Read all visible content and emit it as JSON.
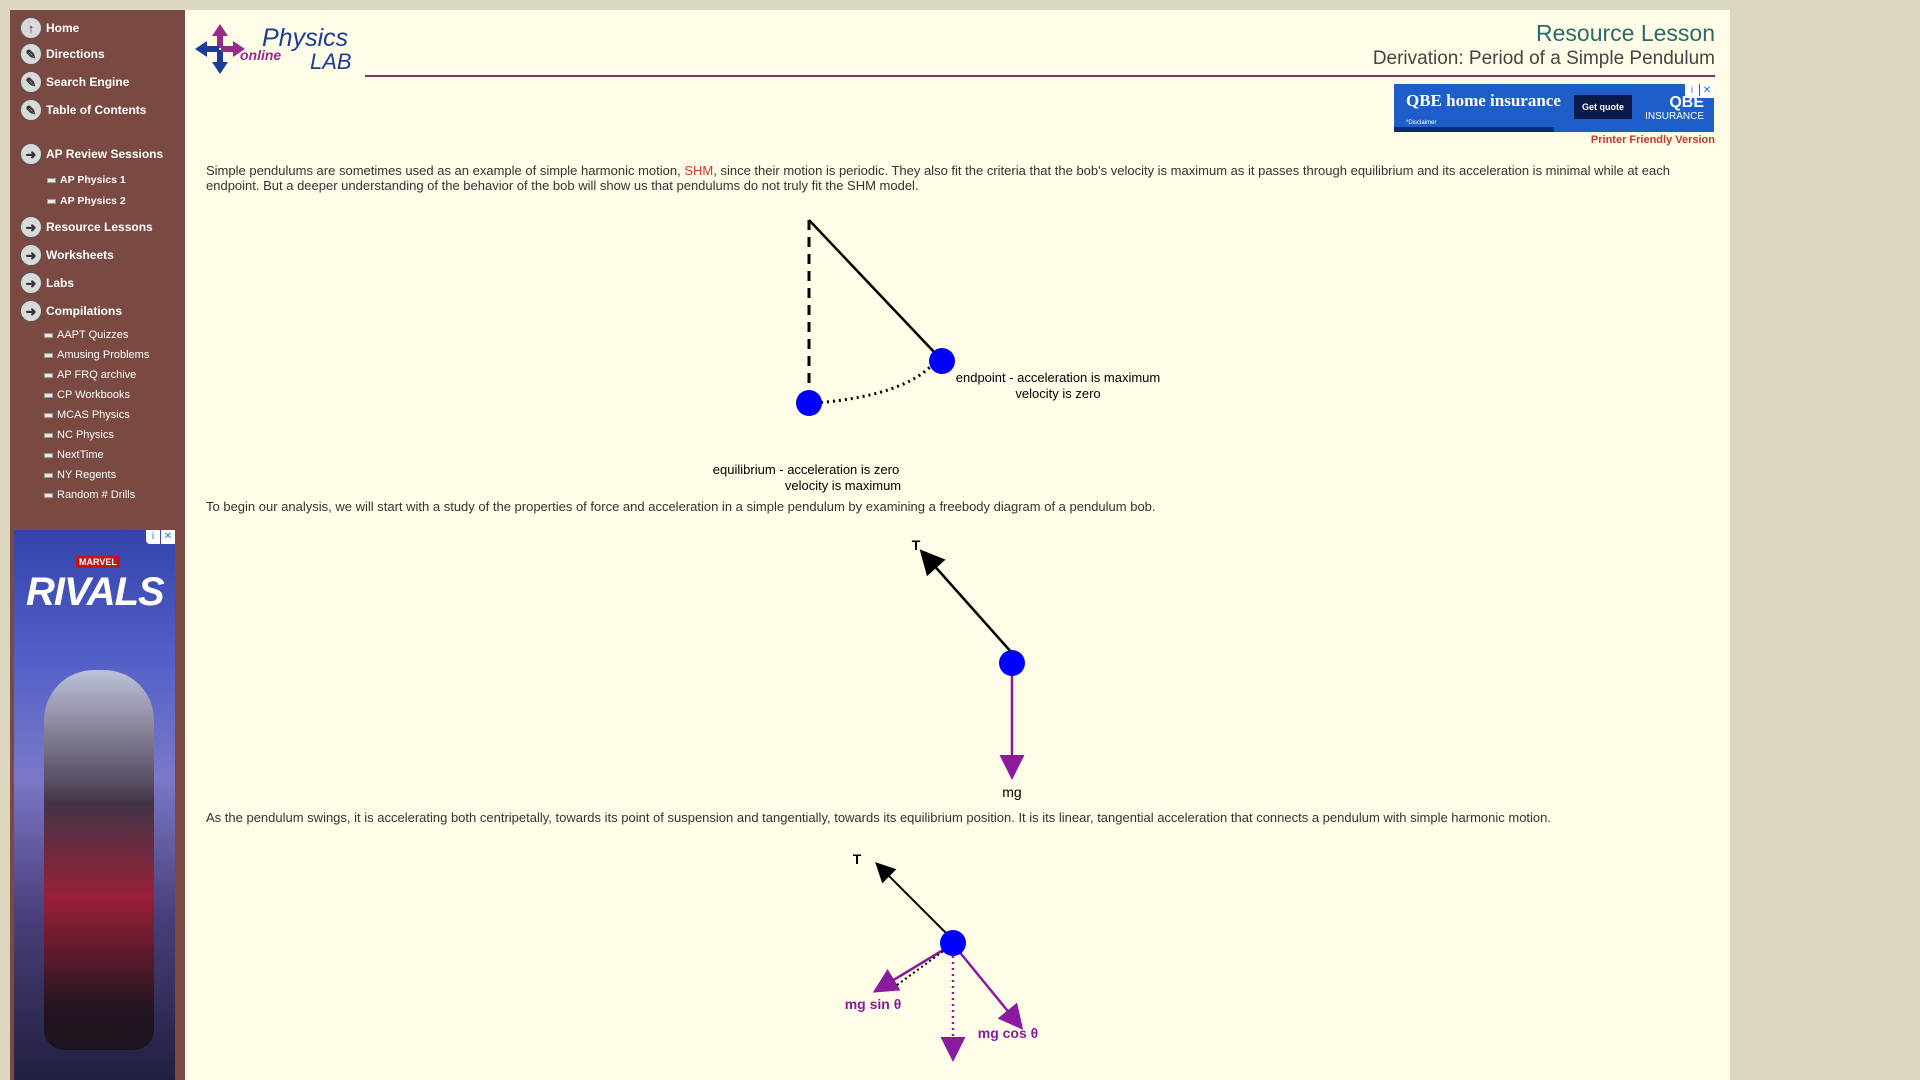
{
  "sidebar": {
    "nav": [
      {
        "label": "Home",
        "icon": "home-icon"
      },
      {
        "label": "Directions",
        "icon": "pencil-icon"
      },
      {
        "label": "Search Engine",
        "icon": "pencil-icon"
      },
      {
        "label": "Table of Contents",
        "icon": "pencil-icon"
      },
      {
        "label": "AP Review Sessions",
        "icon": "arrow-right-icon"
      },
      {
        "label": "Resource Lessons",
        "icon": "arrow-right-icon"
      },
      {
        "label": "Worksheets",
        "icon": "arrow-right-icon"
      },
      {
        "label": "Labs",
        "icon": "arrow-right-icon"
      },
      {
        "label": "Compilations",
        "icon": "arrow-right-icon"
      }
    ],
    "ap_sub": [
      "AP Physics 1",
      "AP Physics 2"
    ],
    "compilations_sub": [
      "AAPT Quizzes",
      "Amusing Problems",
      "AP FRQ archive",
      "CP Workbooks",
      "MCAS Physics",
      "NC Physics",
      "NextTime",
      "NY Regents",
      "Random # Drills"
    ],
    "ad": {
      "brand_small": "MARVEL",
      "brand_big": "RIVALS"
    }
  },
  "logo": {
    "word1": "Physics",
    "word2": "online",
    "word3": "LAB"
  },
  "header": {
    "title": "Resource Lesson",
    "subtitle": "Derivation: Period of a Simple Pendulum"
  },
  "top_ad": {
    "name": "QBE home insurance",
    "cta": "Get quote",
    "disclaimer": "*Disclaimer",
    "logo": "QBE",
    "logo_sub": "INSURANCE"
  },
  "printer_link": "Printer Friendly Version",
  "paragraphs": {
    "p1_before": "Simple pendulums are sometimes used as an example of simple harmonic motion, ",
    "p1_link": "SHM",
    "p1_after": ", since their motion is periodic. They also fit the criteria that the bob's velocity is maximum as it passes through equilibrium and its acceleration is minimal while at each endpoint. But a deeper understanding of the behavior of the bob will show us that pendulums do not truly fit the SHM model.",
    "p2": "To begin our analysis, we will start with a study of the properties of force and acceleration in a simple pendulum by examining a freebody diagram of a pendulum bob.",
    "p3": "As the pendulum swings, it is accelerating both centripetally, towards its point of suspension and tangentially, towards its equilibrium position. It is its linear, tangential acceleration that connects a pendulum with simple harmonic motion."
  },
  "diagram1": {
    "endpoint_line1": "endpoint - acceleration is maximum",
    "endpoint_line2": "velocity is zero",
    "equilibrium_line1": "equilibrium - acceleration is zero",
    "equilibrium_line2": "velocity is maximum"
  },
  "diagram2": {
    "tension": "T",
    "weight": "mg"
  },
  "diagram3": {
    "tension": "T",
    "sin": "mg sin θ",
    "cos": "mg cos θ"
  },
  "colors": {
    "bob": "#0000ff",
    "weight_arrow": "#8b1a9e",
    "link": "#d0392b",
    "sidebar": "#7a4a42",
    "rule": "#80306a"
  }
}
